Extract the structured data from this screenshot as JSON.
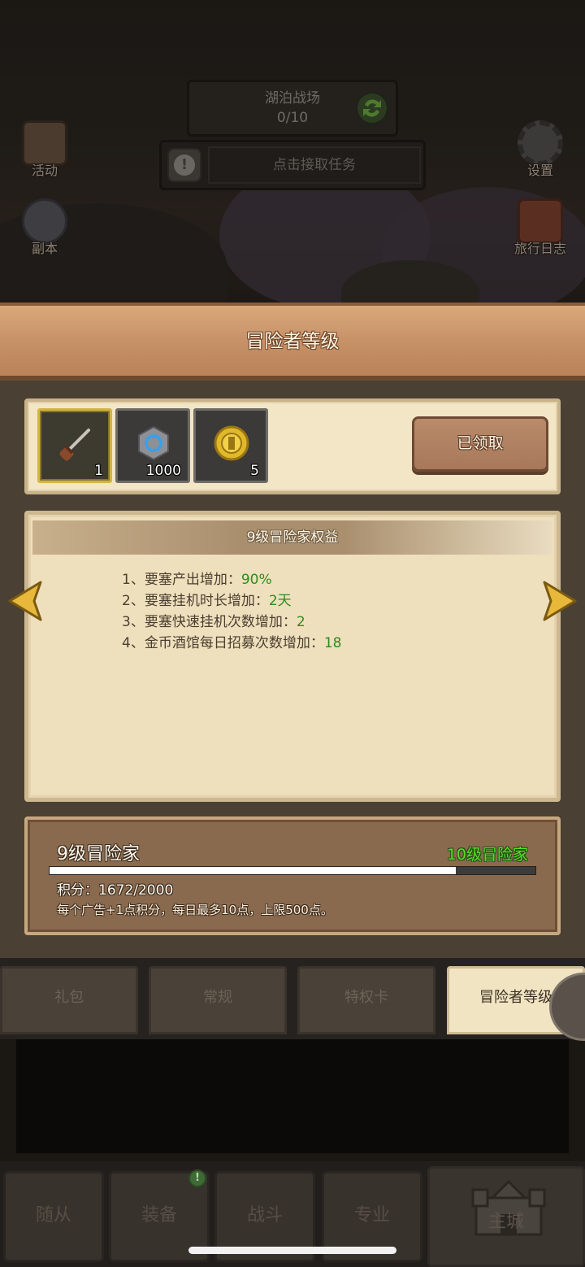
{
  "top_scene": {
    "battle_name": "湖泊战场",
    "battle_progress": "0/10",
    "quest_alert": "!",
    "quest_prompt": "点击接取任务",
    "left_buttons": [
      {
        "label": "活动",
        "icon": "activity-icon"
      },
      {
        "label": "副本",
        "icon": "dungeon-icon"
      }
    ],
    "right_buttons": [
      {
        "label": "设置",
        "icon": "gear-icon"
      },
      {
        "label": "旅行日志",
        "icon": "journal-icon"
      }
    ]
  },
  "panel": {
    "title": "冒险者等级",
    "rewards": [
      {
        "icon": "dagger-icon",
        "qty": "1",
        "selected": true
      },
      {
        "icon": "rune-stone-icon",
        "qty": "1000",
        "selected": false
      },
      {
        "icon": "gold-coin-icon",
        "qty": "5",
        "selected": false
      }
    ],
    "claim_button": "已领取",
    "benefits": {
      "header": "9级冒险家权益",
      "items": [
        {
          "text": "1、要塞产出增加：",
          "value": "90%"
        },
        {
          "text": "2、要塞挂机时长增加：",
          "value": "2天"
        },
        {
          "text": "3、要塞快速挂机次数增加：",
          "value": "2"
        },
        {
          "text": "4、金币酒馆每日招募次数增加：",
          "value": "18"
        }
      ]
    },
    "level": {
      "current": "9级冒险家",
      "next": "10级冒险家",
      "points_text": "积分：1672/2000",
      "points_current": 1672,
      "points_max": 2000,
      "note": "每个广告+1点积分，每日最多10点，上限500点。"
    }
  },
  "tabs": [
    {
      "label": "礼包",
      "active": false
    },
    {
      "label": "常规",
      "active": false
    },
    {
      "label": "特权卡",
      "active": false
    },
    {
      "label": "冒险者等级",
      "active": true
    }
  ],
  "bottom_nav": [
    {
      "label": "随从"
    },
    {
      "label": "装备",
      "badge": "!"
    },
    {
      "label": "战斗"
    },
    {
      "label": "专业"
    },
    {
      "label": "主城"
    }
  ],
  "colors": {
    "highlight_green": "#2f8a1e",
    "next_level_green": "#55e02a",
    "parchment": "#efe0bd",
    "banner": "#c9936a"
  }
}
